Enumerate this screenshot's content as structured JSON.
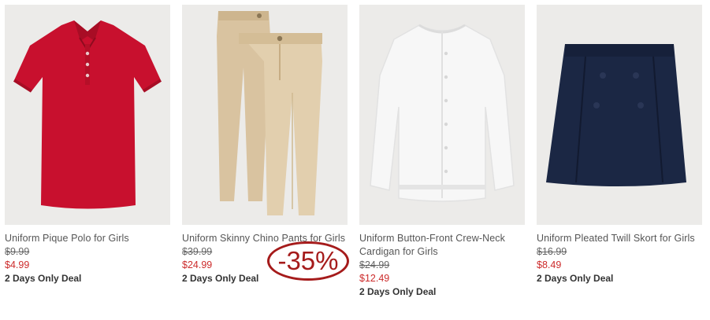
{
  "products": [
    {
      "name": "Uniform Pique Polo for Girls",
      "was": "$9.99",
      "now": "$4.99",
      "deal": "2 Days Only Deal"
    },
    {
      "name": "Uniform Skinny Chino Pants for Girls",
      "was": "$39.99",
      "now": "$24.99",
      "deal": "2 Days Only Deal"
    },
    {
      "name": "Uniform Button-Front Crew-Neck Cardigan for Girls",
      "was": "$24.99",
      "now": "$12.49",
      "deal": "2 Days Only Deal"
    },
    {
      "name": "Uniform Pleated Twill Skort for Girls",
      "was": "$16.99",
      "now": "$8.49",
      "deal": "2 Days Only Deal"
    }
  ],
  "badge": {
    "text": "-35%"
  },
  "colors": {
    "sale_price": "#cc2b2b",
    "badge": "#a51b1b"
  }
}
